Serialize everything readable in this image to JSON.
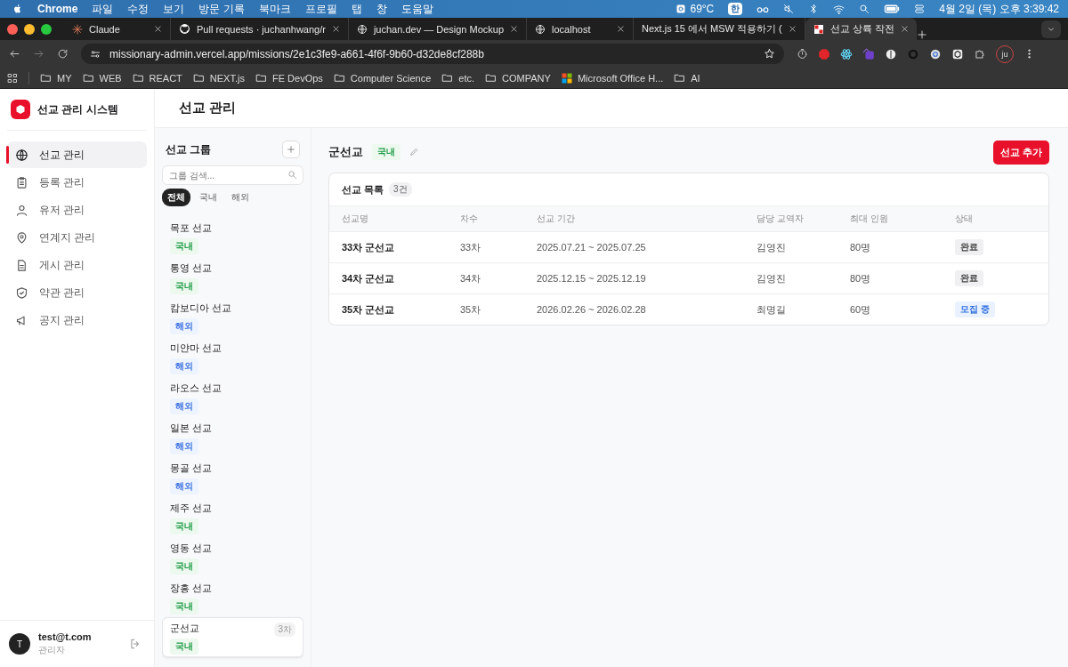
{
  "menubar": {
    "app": "Chrome",
    "menus": [
      "파일",
      "수정",
      "보기",
      "방문 기록",
      "북마크",
      "프로필",
      "탭",
      "창",
      "도움말"
    ],
    "temperature": "69°C",
    "input_method": "한",
    "clock": "4월 2일 (목) 오후 3:39:42"
  },
  "browser": {
    "tabs": [
      {
        "title": "Claude",
        "selected": false
      },
      {
        "title": "Pull requests · juchanhwang/r",
        "selected": false
      },
      {
        "title": "juchan.dev — Design Mockup",
        "selected": false
      },
      {
        "title": "localhost",
        "selected": false
      },
      {
        "title": "Next.js 15 에서 MSW 적용하기 (",
        "selected": false
      },
      {
        "title": "선교 상륙 작전",
        "selected": true
      }
    ],
    "url": "missionary-admin.vercel.app/missions/2e1c3fe9-a661-4f6f-9b60-d32de8cf288b",
    "profile": "ju",
    "bookmarks": [
      {
        "label": "MY",
        "kind": "folder"
      },
      {
        "label": "WEB",
        "kind": "folder"
      },
      {
        "label": "REACT",
        "kind": "folder"
      },
      {
        "label": "NEXT.js",
        "kind": "folder"
      },
      {
        "label": "FE DevOps",
        "kind": "folder"
      },
      {
        "label": "Computer Science",
        "kind": "folder"
      },
      {
        "label": "etc.",
        "kind": "folder"
      },
      {
        "label": "COMPANY",
        "kind": "folder"
      },
      {
        "label": "Microsoft Office H...",
        "kind": "office"
      },
      {
        "label": "AI",
        "kind": "folder"
      }
    ]
  },
  "sidebar": {
    "brand": "선교 관리 시스템",
    "items": [
      {
        "label": "선교 관리",
        "selected": true
      },
      {
        "label": "등록 관리",
        "selected": false
      },
      {
        "label": "유저 관리",
        "selected": false
      },
      {
        "label": "연계지 관리",
        "selected": false
      },
      {
        "label": "게시 관리",
        "selected": false
      },
      {
        "label": "약관 관리",
        "selected": false
      },
      {
        "label": "공지 관리",
        "selected": false
      }
    ],
    "user": {
      "initial": "T",
      "email": "test@t.com",
      "role": "관리자"
    }
  },
  "page_title": "선교 관리",
  "groups": {
    "title": "선교 그룹",
    "search": {
      "placeholder": "그룹 검색..."
    },
    "filters": [
      {
        "label": "전체",
        "selected": true
      },
      {
        "label": "국내",
        "selected": false
      },
      {
        "label": "해외",
        "selected": false
      }
    ],
    "items": [
      {
        "name": "목포 선교",
        "region": "국내",
        "kind": "domestic",
        "selected": false
      },
      {
        "name": "통영 선교",
        "region": "국내",
        "kind": "domestic",
        "selected": false
      },
      {
        "name": "캄보디아 선교",
        "region": "해외",
        "kind": "overseas",
        "selected": false
      },
      {
        "name": "미얀마 선교",
        "region": "해외",
        "kind": "overseas",
        "selected": false
      },
      {
        "name": "라오스 선교",
        "region": "해외",
        "kind": "overseas",
        "selected": false
      },
      {
        "name": "일본 선교",
        "region": "해외",
        "kind": "overseas",
        "selected": false
      },
      {
        "name": "몽골 선교",
        "region": "해외",
        "kind": "overseas",
        "selected": false
      },
      {
        "name": "제주 선교",
        "region": "국내",
        "kind": "domestic",
        "selected": false
      },
      {
        "name": "영동 선교",
        "region": "국내",
        "kind": "domestic",
        "selected": false
      },
      {
        "name": "장흥 선교",
        "region": "국내",
        "kind": "domestic",
        "selected": false
      },
      {
        "name": "군선교",
        "region": "국내",
        "kind": "domestic",
        "count": "3차",
        "selected": true
      }
    ]
  },
  "detail": {
    "title": "군선교",
    "region": {
      "label": "국내",
      "kind": "domestic"
    },
    "add_button": "선교 추가",
    "list": {
      "title": "선교 목록",
      "count": "3건",
      "columns": [
        "선교명",
        "차수",
        "선교 기간",
        "담당 교역자",
        "최대 인원",
        "상태"
      ],
      "rows": [
        {
          "name": "33차 군선교",
          "round": "33차",
          "period": "2025.07.21 ~ 2025.07.25",
          "leader": "김영진",
          "capacity": "80명",
          "status": "완료",
          "kind": "done"
        },
        {
          "name": "34차 군선교",
          "round": "34차",
          "period": "2025.12.15 ~ 2025.12.19",
          "leader": "김영진",
          "capacity": "80명",
          "status": "완료",
          "kind": "done"
        },
        {
          "name": "35차 군선교",
          "round": "35차",
          "period": "2026.02.26 ~ 2026.02.28",
          "leader": "최명길",
          "capacity": "60명",
          "status": "모집 중",
          "kind": "recruiting"
        }
      ]
    }
  }
}
